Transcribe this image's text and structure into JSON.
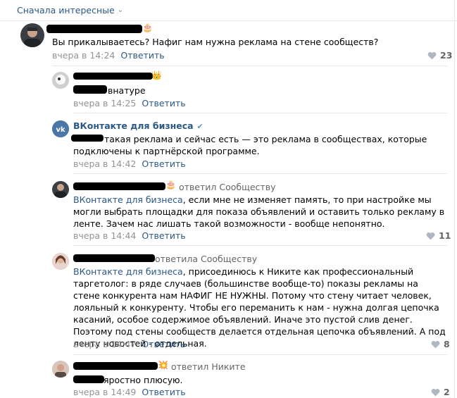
{
  "sort_label": "Сначала интересные",
  "comments": [
    {
      "text": "Вы прикалываетесь? Нафиг нам нужна реклама на стене сообществ?",
      "date": "вчера в 14:24",
      "reply": "Ответить",
      "likes": "23"
    },
    {
      "text": "внатуре",
      "date": "вчера в 14:25",
      "reply": "Ответить"
    },
    {
      "author": "ВКонтакте для бизнеса",
      "text": "такая реклама и сейчас есть — это реклама в сообществах, которые подключены к партнёрской программе.",
      "date": "вчера в 14:42",
      "reply": "Ответить"
    },
    {
      "replied": "ответил Сообществу",
      "addressee": "ВКонтакте для бизнеса",
      "text": ", если мне не изменяет память, то при настройке мы могли выбрать площадки для показа объявлений и оставить только рекламу в ленте. Зачем нас лишать такой возможности - вообще непонятно.",
      "date": "вчера в 14:44",
      "reply": "Ответить",
      "likes": "11"
    },
    {
      "replied": "ответила Сообществу",
      "addressee": "ВКонтакте для бизнеса",
      "text": ", присоединюсь к Никите как профессиональный таргетолог: в ряде случаев (большинстве вообще-то) показы рекламы на стене конкурента нам НАФИГ НЕ НУЖНЫ. Потому что стену читает человек, лояльный к конкуренту. Чтобы его переманить к нам - нужна долгая цепочка касаний, особое содержимое объявлений. Иначе это пустой слив денег. Поэтому под стены сообществ делается отдельная цепочка объявлений. А под ленту новостей - отдельная.",
      "date": "вчера в 14:47",
      "reply": "Ответить",
      "likes": "8"
    },
    {
      "replied": "ответил Никите",
      "text": "яростно плюсую.",
      "date": "вчера в 14:49",
      "reply": "Ответить",
      "likes": "2"
    }
  ],
  "colors": {
    "link": "#2a5885",
    "meta": "#939393",
    "divider": "#e7e8ec"
  }
}
